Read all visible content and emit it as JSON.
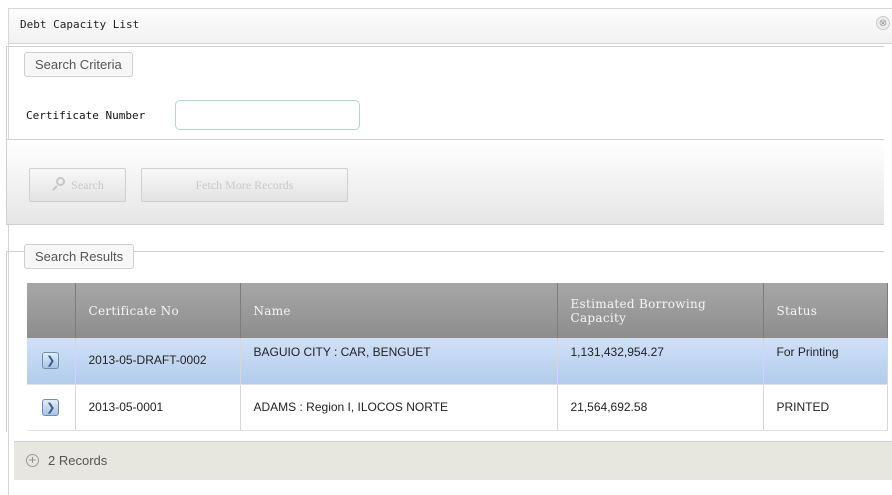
{
  "window": {
    "title": "Debt Capacity List",
    "close_icon": "⊗"
  },
  "search_criteria": {
    "legend": "Search Criteria",
    "certificate_label": "Certificate Number",
    "certificate_value": ""
  },
  "toolbar": {
    "search_label": "Search",
    "fetch_label": "Fetch More Records"
  },
  "results": {
    "legend": "Search Results",
    "columns": [
      "Certificate No",
      "Name",
      "Estimated Borrowing Capacity",
      "Status"
    ],
    "rows": [
      {
        "certificate_no": "2013-05-DRAFT-0002",
        "name": "BAGUIO CITY : CAR, BENGUET",
        "capacity": "1,131,432,954.27",
        "status": "For Printing"
      },
      {
        "certificate_no": "2013-05-0001",
        "name": "ADAMS : Region I, ILOCOS NORTE",
        "capacity": "21,564,692.58",
        "status": "PRINTED"
      }
    ]
  },
  "footer": {
    "record_count": "2 Records"
  },
  "colors": {
    "selected_row": "#c2d7f0",
    "header_bg": "#9a9a9a"
  }
}
